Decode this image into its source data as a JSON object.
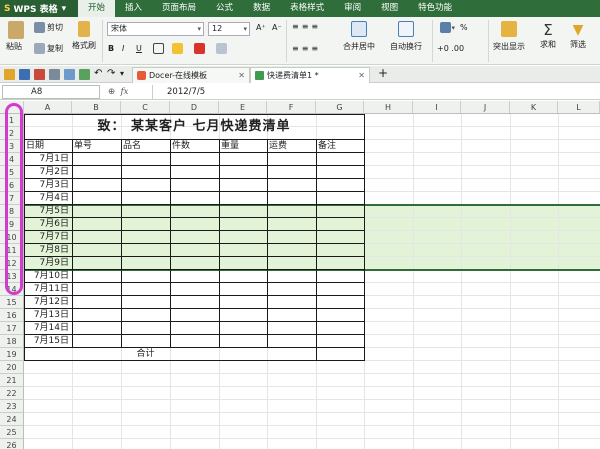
{
  "app": {
    "name": "WPS 表格"
  },
  "menu": [
    "开始",
    "插入",
    "页面布局",
    "公式",
    "数据",
    "表格样式",
    "审阅",
    "视图",
    "特色功能"
  ],
  "ribbon": {
    "cut": "剪切",
    "paste": "粘贴",
    "copy": "复制",
    "format_painter": "格式刷",
    "font_name": "宋体",
    "font_size": "12",
    "bold": "B",
    "italic": "I",
    "underline": "U",
    "grow": "A⁺",
    "shrink": "A⁻",
    "merge": "合并居中",
    "wrap": "自动换行",
    "numfmt": "常规",
    "percent": "%",
    "highlight": "突出显示",
    "sum": "求和",
    "filter": "筛选"
  },
  "tabs": [
    {
      "label": "Docer-在线模板",
      "active": false
    },
    {
      "label": "快递费清单1 *",
      "active": true
    }
  ],
  "formula": {
    "cell_ref": "A8",
    "fx": "fx",
    "value": "2012/7/5"
  },
  "columns": [
    "A",
    "B",
    "C",
    "D",
    "E",
    "F",
    "G",
    "H",
    "I",
    "J",
    "K",
    "L"
  ],
  "row_numbers": [
    "1",
    "2",
    "3",
    "4",
    "5",
    "6",
    "7",
    "8",
    "9",
    "10",
    "11",
    "12",
    "13",
    "14",
    "15",
    "16",
    "17",
    "18",
    "19",
    "20",
    "21",
    "22",
    "23",
    "24",
    "25",
    "26"
  ],
  "sheet": {
    "title": "致：  某某客户    七月快递费清单",
    "headers": [
      "日期",
      "单号",
      "品名",
      "件数",
      "重量",
      "运费",
      "备注"
    ],
    "dates": [
      "7月1日",
      "7月2日",
      "7月3日",
      "7月4日",
      "7月5日",
      "7月6日",
      "7月7日",
      "7月8日",
      "7月9日",
      "7月10日",
      "7月11日",
      "7月12日",
      "7月13日",
      "7月14日",
      "7月15日"
    ],
    "total_label": "合计"
  },
  "colors": {
    "menu_bg": "#2f6d3b",
    "highlight_row": "#e2f3d7",
    "annotation": "#d43ad0"
  }
}
